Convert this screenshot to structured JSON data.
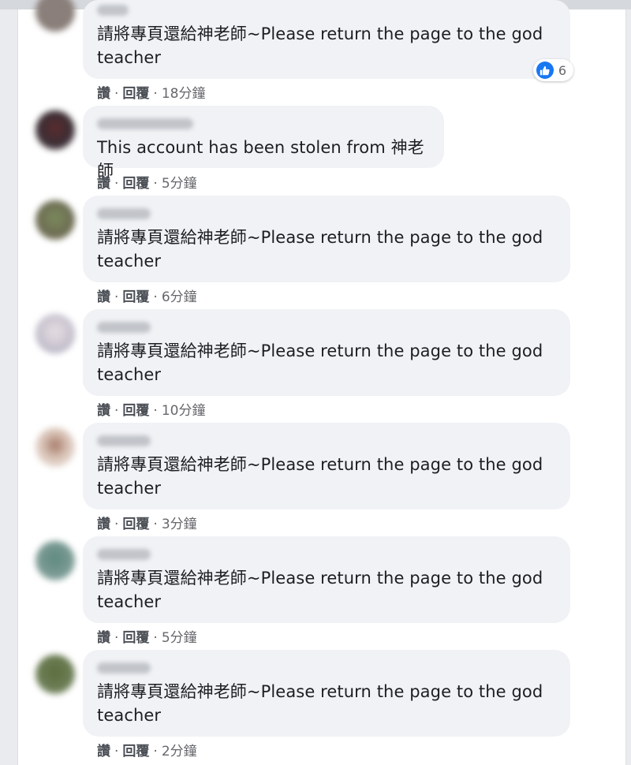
{
  "action_labels": {
    "like": "讚",
    "reply": "回覆",
    "separator": "·"
  },
  "colors": {
    "like_blue": "#1877f2",
    "bubble_bg": "#f0f2f5"
  },
  "comments": [
    {
      "text": "請將專頁還給神老師~Please return the page to the god teacher",
      "time": "18分鐘",
      "reaction_count": "6",
      "reaction_icon": "thumbs-up-icon"
    },
    {
      "text": "This account has been stolen from 神老師",
      "time": "5分鐘"
    },
    {
      "text": "請將專頁還給神老師~Please return the page to the god teacher",
      "time": "6分鐘"
    },
    {
      "text": "請將專頁還給神老師~Please return the page to the god teacher",
      "time": "10分鐘"
    },
    {
      "text": "請將專頁還給神老師~Please return the page to the god teacher",
      "time": "3分鐘"
    },
    {
      "text": "請將專頁還給神老師~Please return the page to the god teacher",
      "time": "5分鐘"
    },
    {
      "text": "請將專頁還給神老師~Please return the page to the god teacher",
      "time": "2分鐘"
    }
  ]
}
